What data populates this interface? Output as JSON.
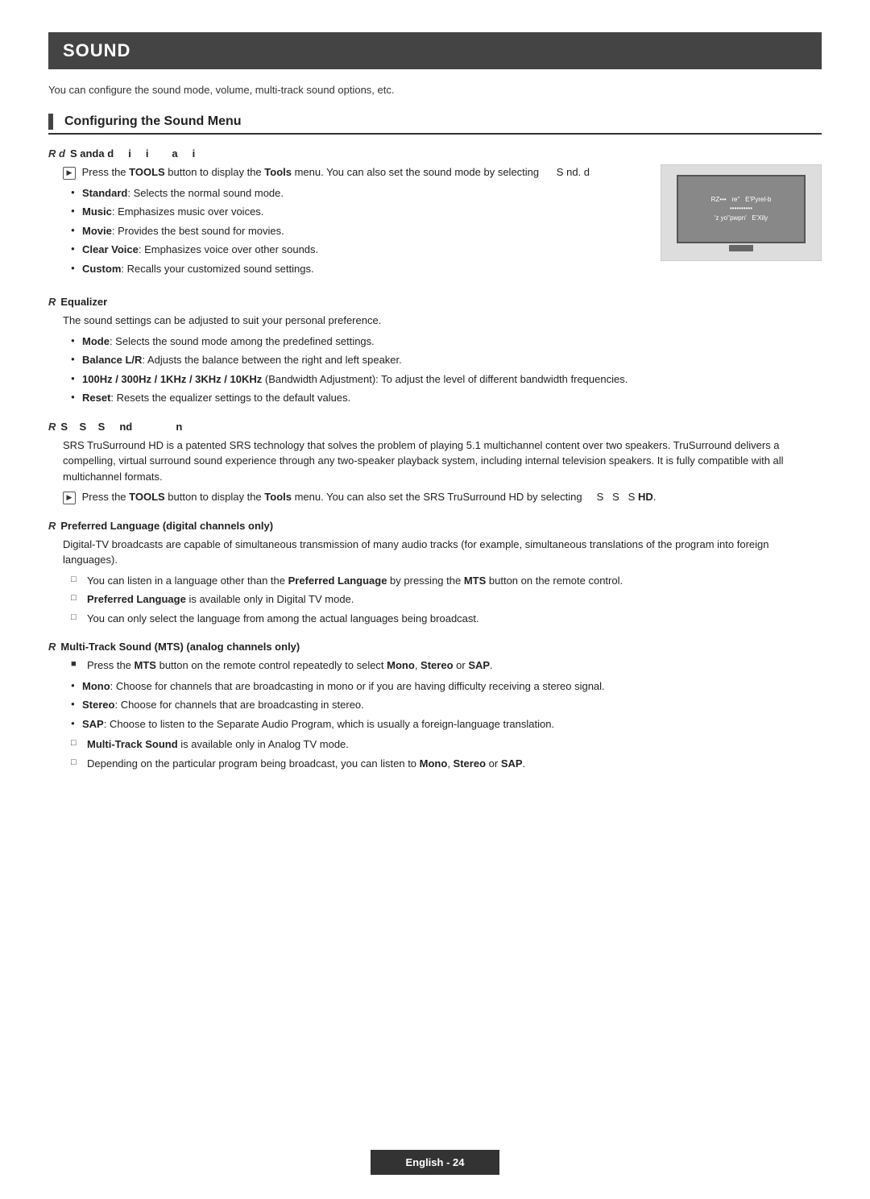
{
  "page": {
    "title": "SOUND",
    "intro": "You can configure the sound mode, volume, multi-track sound options, etc.",
    "section_heading": "Configuring the Sound Menu",
    "footer": "English - 24"
  },
  "subsections": [
    {
      "id": "sound-mode",
      "r_label": "R",
      "title": "Sound Standard i i a i",
      "has_image": true,
      "intro_note": "Press the TOOLS button to display the Tools menu. You can also set the sound mode by selecting S nd. d",
      "bullets": [
        {
          "bold": "Standard",
          "rest": ": Selects the normal sound mode."
        },
        {
          "bold": "Music",
          "rest": ": Emphasizes music over voices."
        },
        {
          "bold": "Movie",
          "rest": ": Provides the best sound for movies."
        },
        {
          "bold": "Clear Voice",
          "rest": ": Emphasizes voice over other sounds."
        },
        {
          "bold": "Custom",
          "rest": ": Recalls your customized sound settings."
        }
      ]
    },
    {
      "id": "equalizer",
      "r_label": "R",
      "title": "Equalizer",
      "intro": "The sound settings can be adjusted to suit your personal preference.",
      "bullets": [
        {
          "bold": "Mode",
          "rest": ": Selects the sound mode among the predefined settings."
        },
        {
          "bold": "Balance L/R",
          "rest": ": Adjusts the balance between the right and left speaker."
        },
        {
          "bold": "100Hz / 300Hz / 1KHz / 3KHz / 10KHz",
          "rest": " (Bandwidth Adjustment): To adjust the level of different bandwidth frequencies."
        },
        {
          "bold": "Reset",
          "rest": ": Resets the equalizer settings to the default values."
        }
      ]
    },
    {
      "id": "srs",
      "r_label": "R",
      "title": "S S S nd n",
      "body": "SRS TruSurround HD is a patented SRS technology that solves the problem of playing 5.1 multichannel content over two speakers. TruSurround delivers a compelling, virtual surround sound experience through any two-speaker playback system, including internal television speakers. It is fully compatible with all multichannel formats.",
      "tools_note": "Press the TOOLS button to display the Tools menu. You can also set the SRS TruSurround HD by selecting S S S HD."
    },
    {
      "id": "preferred-language",
      "r_label": "R",
      "title": "Preferred Language (digital channels only)",
      "body": "Digital-TV broadcasts are capable of simultaneous transmission of many audio tracks (for example, simultaneous translations of the program into foreign languages).",
      "notes": [
        "You can listen in a language other than the Preferred Language by pressing the MTS button on the remote control.",
        "Preferred Language is available only in Digital TV mode.",
        "You can only select the language from among the actual languages being broadcast."
      ],
      "notes_bold": [
        "Preferred Language",
        "MTS",
        "Preferred Language"
      ]
    },
    {
      "id": "mts",
      "r_label": "R",
      "title": "Multi-Track Sound (MTS) (analog channels only)",
      "mts_note": "Press the MTS button on the remote control repeatedly to select Mono, Stereo or SAP.",
      "bullets": [
        {
          "bold": "Mono",
          "rest": ": Choose for channels that are broadcasting in mono or if you are having difficulty receiving a stereo signal."
        },
        {
          "bold": "Stereo",
          "rest": ": Choose for channels that are broadcasting in stereo."
        },
        {
          "bold": "SAP",
          "rest": ": Choose to listen to the Separate Audio Program, which is usually a foreign-language translation."
        }
      ],
      "extra_notes": [
        "Multi-Track Sound is available only in Analog TV mode.",
        "Depending on the particular program being broadcast, you can listen to Mono, Stereo or SAP."
      ]
    }
  ]
}
